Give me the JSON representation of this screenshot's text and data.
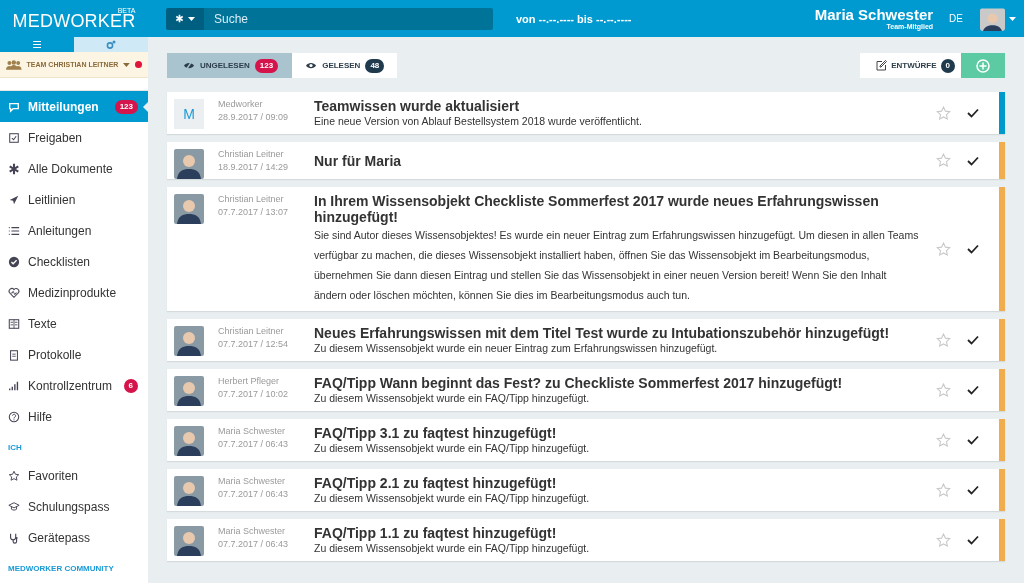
{
  "header": {
    "logo": "MEDWORKER",
    "logo_badge": "BETA",
    "search": {
      "placeholder": "Suche"
    },
    "date_range": "von --.--.---- bis --.--.----",
    "user": {
      "name": "Maria Schwester",
      "role": "Team-Mitglied"
    },
    "language": "DE"
  },
  "sidebar": {
    "view_tabs": [
      {
        "kind": "menu",
        "selected": true
      },
      {
        "kind": "settings",
        "selected": false
      }
    ],
    "team": {
      "label": "TEAM CHRISTIAN LEITNER",
      "alert": true
    },
    "sections": [
      {
        "items": [
          {
            "label": "Mitteilungen",
            "selected": true,
            "badge": "123"
          },
          {
            "label": "Freigaben",
            "selected": false
          },
          {
            "label": "Alle Dokumente",
            "selected": false
          },
          {
            "label": "Leitlinien",
            "selected": false
          },
          {
            "label": "Anleitungen",
            "selected": false
          },
          {
            "label": "Checklisten",
            "selected": false
          },
          {
            "label": "Medizinprodukte",
            "selected": false
          },
          {
            "label": "Texte",
            "selected": false
          },
          {
            "label": "Protokolle",
            "selected": false
          },
          {
            "label": "Kontrollzentrum",
            "selected": false,
            "badge": "6"
          },
          {
            "label": "Hilfe",
            "selected": false
          }
        ]
      },
      {
        "heading": "ICH",
        "items": [
          {
            "label": "Favoriten",
            "selected": false
          },
          {
            "label": "Schulungspass",
            "selected": false
          },
          {
            "label": "Gerätepass",
            "selected": false
          }
        ]
      },
      {
        "heading": "MEDWORKER COMMUNITY"
      }
    ]
  },
  "main": {
    "tabs": [
      {
        "kind": "unread",
        "label": "UNGELESEN",
        "count": "123",
        "selected": true
      },
      {
        "kind": "read",
        "label": "GELESEN",
        "count": "48",
        "selected": false
      }
    ],
    "drafts": {
      "label": "ENTWÜRFE",
      "count": "0"
    },
    "messages": [
      {
        "avatar": {
          "kind": "letter",
          "letter": "M"
        },
        "sender": "Medworker",
        "date": "28.9.2017 / 09:09",
        "title": "Teamwissen wurde aktualisiert",
        "body": "Eine neue Version von Ablauf Bestellsystem 2018 wurde veröffentlicht.",
        "starred": false,
        "color": "#0099cc"
      },
      {
        "avatar": {
          "kind": "photo"
        },
        "sender": "Christian Leitner",
        "date": "18.9.2017 / 14:29",
        "title": "Nur für Maria",
        "starred": false,
        "color": "#f0ad4e"
      },
      {
        "avatar": {
          "kind": "photo"
        },
        "sender": "Christian Leitner",
        "date": "07.7.2017 / 13:07",
        "title": "In Ihrem Wissensobjekt Checkliste Sommerfest 2017 wurde neues Erfahrungswissen hinzugefügt!",
        "body": "Sie sind Autor dieses Wissensobjektes! Es wurde ein neuer Eintrag zum Erfahrungswissen hinzugefügt. Um diesen in allen Teams verfügbar zu machen, die dieses Wissensobjekt installiert haben, öffnen Sie das Wissensobjekt im Bearbeitungsmodus, übernehmen Sie dann diesen Eintrag und stellen Sie das Wissensobjekt in einer neuen Version bereit! Wenn Sie den Inhalt ändern oder löschen möchten, können Sie dies im Bearbeitungsmodus auch tun.",
        "starred": false,
        "color": "#f0ad4e"
      },
      {
        "avatar": {
          "kind": "photo"
        },
        "sender": "Christian Leitner",
        "date": "07.7.2017 / 12:54",
        "title": "Neues Erfahrungswissen mit dem Titel Test wurde zu Intubationszubehör hinzugefügt!",
        "body": "Zu diesem Wissensobjekt wurde ein neuer Eintrag zum Erfahrungswissen hinzugefügt.",
        "starred": false,
        "color": "#f0ad4e"
      },
      {
        "avatar": {
          "kind": "photo"
        },
        "sender": "Herbert Pfleger",
        "date": "07.7.2017 / 10:02",
        "title": "FAQ/Tipp Wann beginnt das Fest? zu Checkliste Sommerfest 2017 hinzugefügt!",
        "body": "Zu diesem Wissensobjekt wurde ein FAQ/Tipp hinzugefügt.",
        "starred": false,
        "color": "#f0ad4e"
      },
      {
        "avatar": {
          "kind": "photo"
        },
        "sender": "Maria Schwester",
        "date": "07.7.2017 / 06:43",
        "title": "FAQ/Tipp 3.1 zu faqtest hinzugefügt!",
        "body": "Zu diesem Wissensobjekt wurde ein FAQ/Tipp hinzugefügt.",
        "starred": false,
        "color": "#f0ad4e"
      },
      {
        "avatar": {
          "kind": "photo"
        },
        "sender": "Maria Schwester",
        "date": "07.7.2017 / 06:43",
        "title": "FAQ/Tipp 2.1 zu faqtest hinzugefügt!",
        "body": "Zu diesem Wissensobjekt wurde ein FAQ/Tipp hinzugefügt.",
        "starred": false,
        "color": "#f0ad4e"
      },
      {
        "avatar": {
          "kind": "photo"
        },
        "sender": "Maria Schwester",
        "date": "07.7.2017 / 06:43",
        "title": "FAQ/Tipp 1.1 zu faqtest hinzugefügt!",
        "body": "Zu diesem Wissensobjekt wurde ein FAQ/Tipp hinzugefügt.",
        "starred": false,
        "color": "#f0ad4e"
      }
    ]
  }
}
